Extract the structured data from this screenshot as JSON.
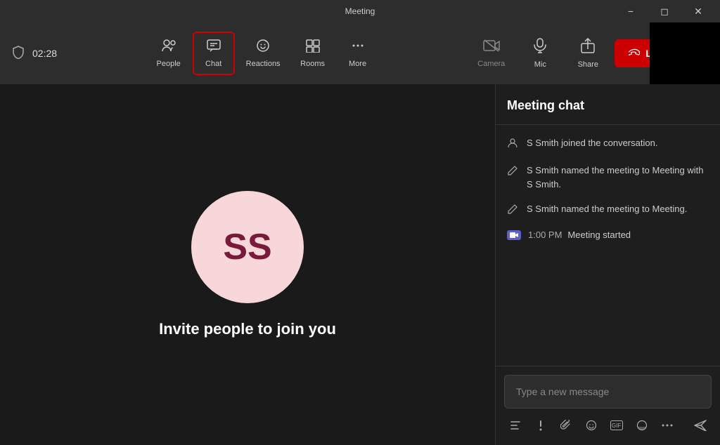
{
  "titleBar": {
    "title": "Meeting",
    "minimizeLabel": "minimize",
    "maximizeLabel": "maximize",
    "closeLabel": "close"
  },
  "toolbar": {
    "timerLabel": "02:28",
    "navItems": [
      {
        "id": "people",
        "label": "People",
        "icon": "👥"
      },
      {
        "id": "chat",
        "label": "Chat",
        "icon": "💬",
        "active": true
      },
      {
        "id": "reactions",
        "label": "Reactions",
        "icon": "😊"
      },
      {
        "id": "rooms",
        "label": "Rooms",
        "icon": "⊞"
      },
      {
        "id": "more",
        "label": "More",
        "icon": "•••"
      }
    ],
    "actionItems": [
      {
        "id": "camera",
        "label": "Camera",
        "icon": "📷",
        "disabled": true
      },
      {
        "id": "mic",
        "label": "Mic",
        "icon": "🎙️"
      },
      {
        "id": "share",
        "label": "Share",
        "icon": "⬆"
      }
    ],
    "leaveLabel": "Leave"
  },
  "videoArea": {
    "avatarInitials": "SS",
    "inviteText": "Invite people to join you"
  },
  "chatPanel": {
    "title": "Meeting chat",
    "messages": [
      {
        "id": 1,
        "type": "join",
        "icon": "person",
        "text": "S Smith joined the conversation."
      },
      {
        "id": 2,
        "type": "rename",
        "icon": "pencil",
        "text": "S Smith named the meeting to Meeting with S Smith."
      },
      {
        "id": 3,
        "type": "rename",
        "icon": "pencil",
        "text": "S Smith named the meeting to Meeting."
      },
      {
        "id": 4,
        "type": "meeting-started",
        "time": "1:00 PM",
        "text": "Meeting started"
      }
    ],
    "inputPlaceholder": "Type a new message",
    "toolbarIcons": [
      {
        "id": "format",
        "icon": "A"
      },
      {
        "id": "attach",
        "icon": "!"
      },
      {
        "id": "paperclip",
        "icon": "📎"
      },
      {
        "id": "emoji",
        "icon": "😊"
      },
      {
        "id": "gif",
        "icon": "GIF"
      },
      {
        "id": "sticker",
        "icon": "🙂"
      },
      {
        "id": "more-options",
        "icon": "•••"
      }
    ]
  }
}
